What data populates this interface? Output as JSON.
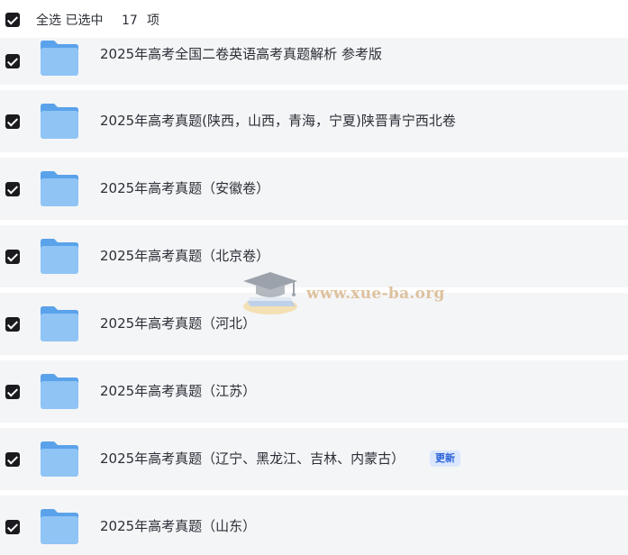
{
  "header": {
    "select_all_label": "全选  已选中",
    "selected_count": "17",
    "count_unit": "项"
  },
  "rows": [
    {
      "title": "2025年高考全国二卷英语高考真题解析 参考版",
      "badge": ""
    },
    {
      "title": "2025年高考真题(陕西，山西，青海，宁夏)陕晋青宁西北卷",
      "badge": ""
    },
    {
      "title": "2025年高考真题（安徽卷）",
      "badge": ""
    },
    {
      "title": "2025年高考真题（北京卷）",
      "badge": ""
    },
    {
      "title": "2025年高考真题（河北）",
      "badge": ""
    },
    {
      "title": "2025年高考真题（江苏）",
      "badge": ""
    },
    {
      "title": "2025年高考真题（辽宁、黑龙江、吉林、内蒙古）",
      "badge": "更新"
    },
    {
      "title": "2025年高考真题（山东）",
      "badge": ""
    }
  ],
  "watermark": {
    "text": "www.xue-ba.org"
  },
  "colors": {
    "row_bg": "#f4f5f7",
    "folder": "#72b4f2",
    "badge_bg": "#dbe7fd",
    "badge_fg": "#2a62d8"
  },
  "icons": {
    "folder": "folder-icon",
    "checkbox": "checkbox-checked-icon"
  }
}
